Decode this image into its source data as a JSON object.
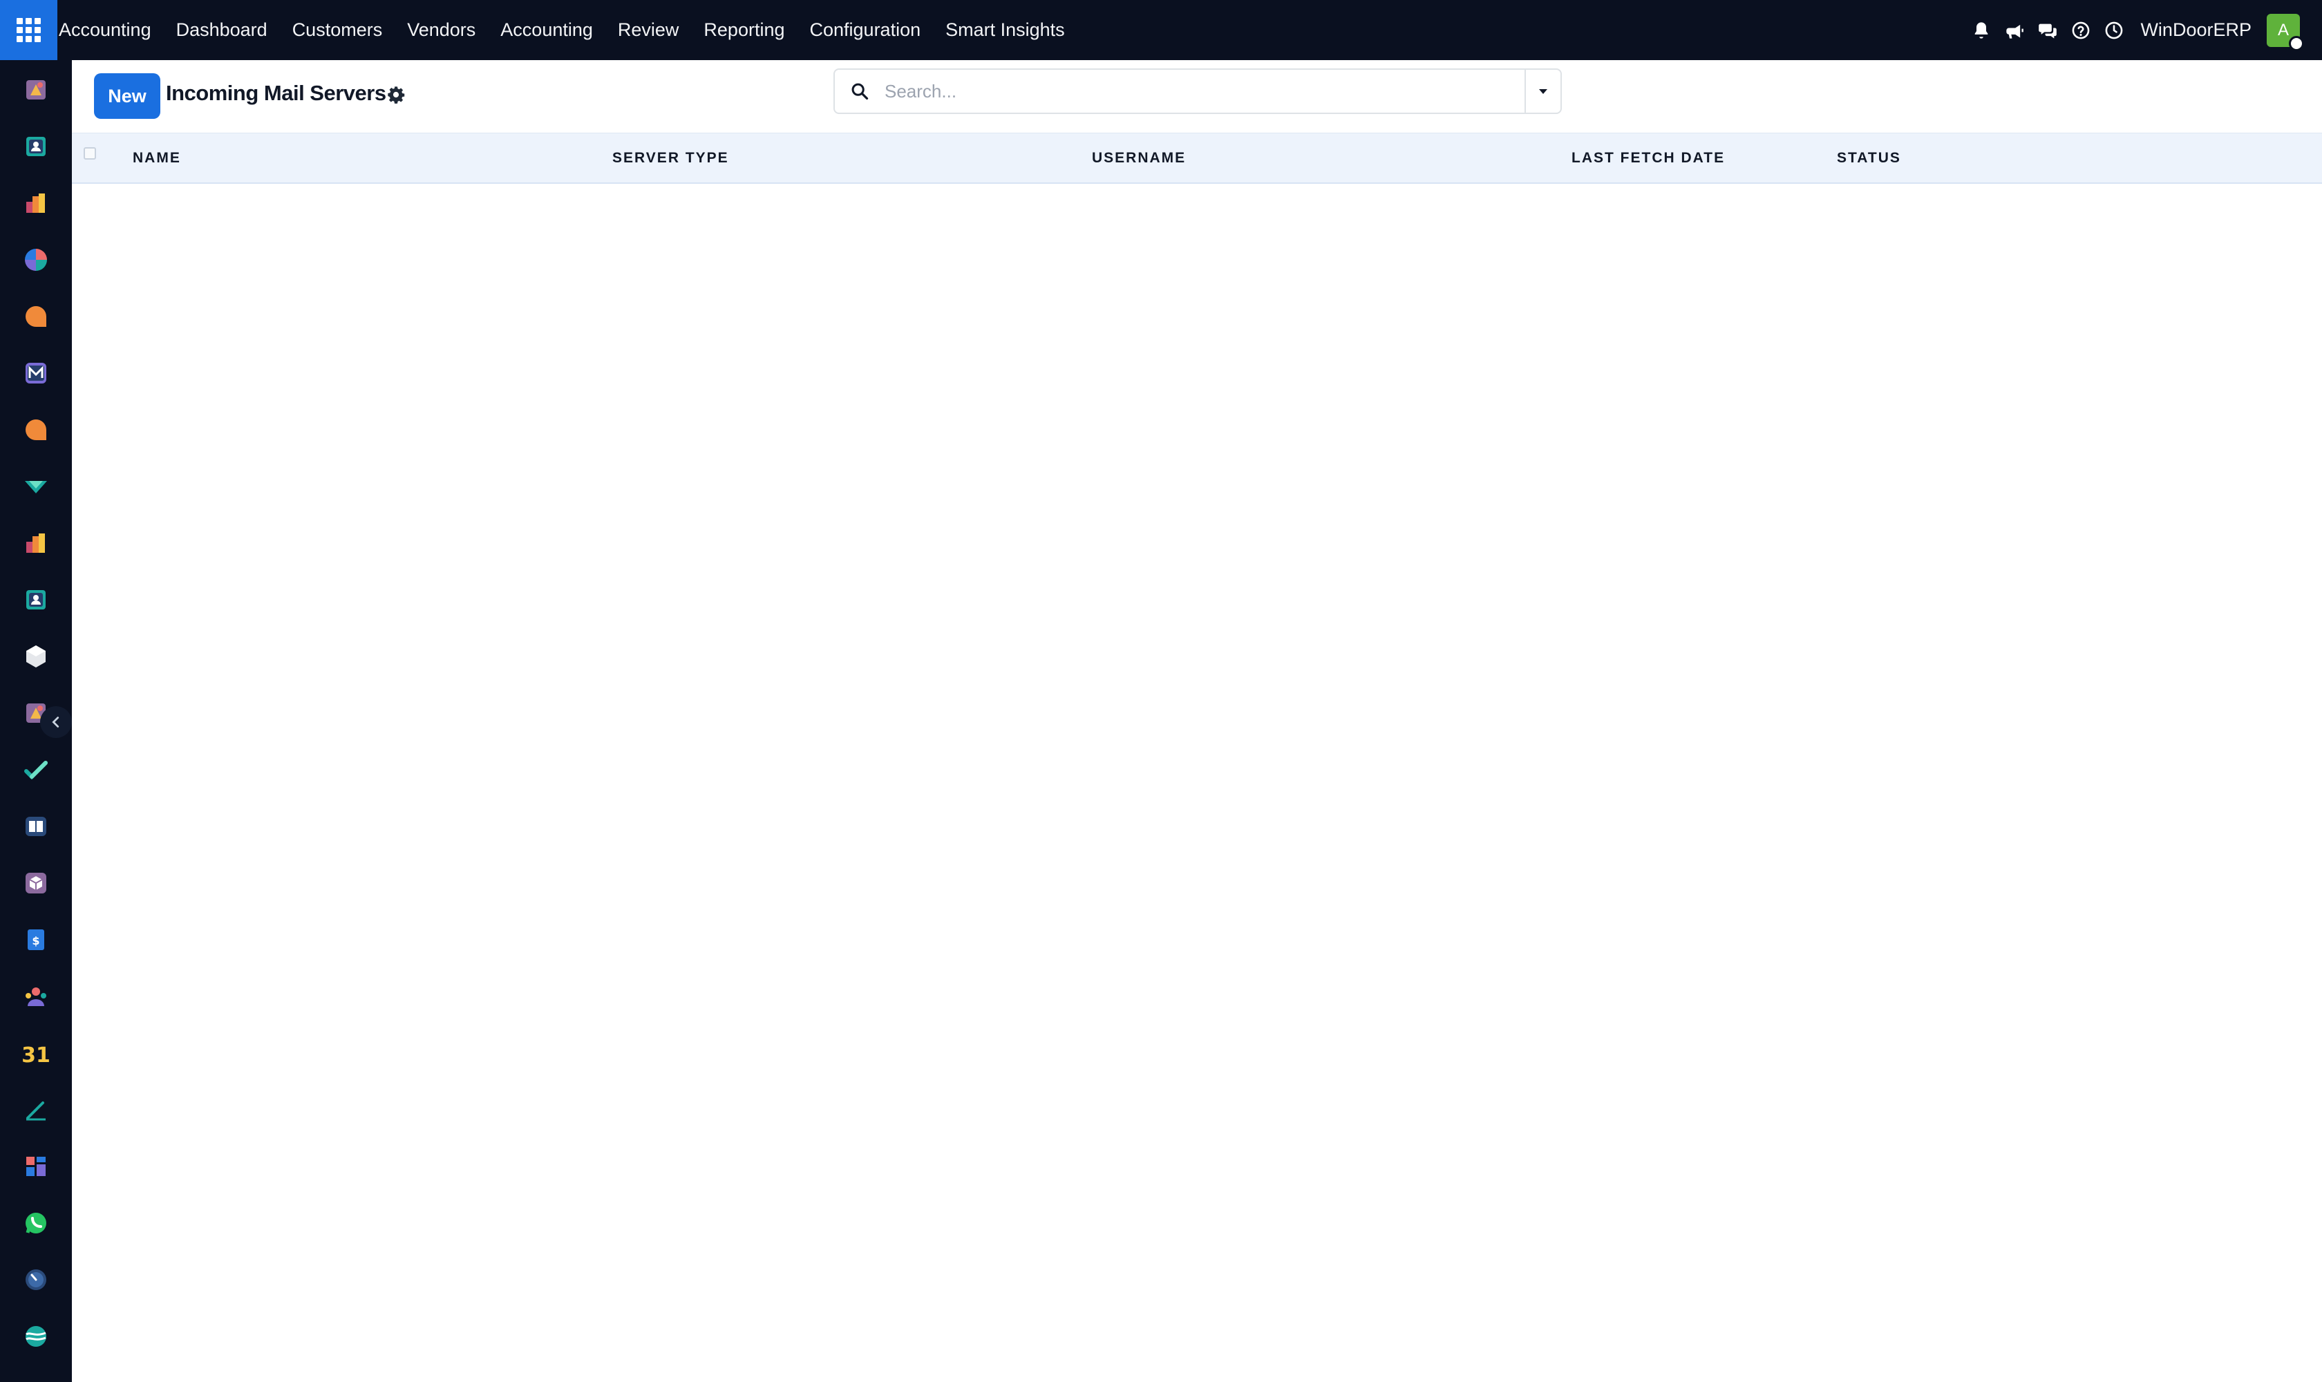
{
  "topbar": {
    "apps_icon": "grid-icon",
    "nav": [
      "Accounting",
      "Dashboard",
      "Customers",
      "Vendors",
      "Accounting",
      "Review",
      "Reporting",
      "Configuration",
      "Smart Insights"
    ],
    "icons": [
      "bell-icon",
      "megaphone-icon",
      "chat-icon",
      "help-icon",
      "clock-icon"
    ],
    "company": "WinDoorERP",
    "avatar_letter": "A",
    "bar_color": "#0a1020",
    "accent": "#1a6fe0"
  },
  "sidebar": {
    "apps": [
      "documents-app-icon",
      "contacts-app-icon",
      "accounting-app-icon",
      "discuss-app-icon",
      "live-chat-app-icon",
      "email-marketing-app-icon",
      "live-chat-app-icon",
      "website-app-icon",
      "accounting-app-icon",
      "contacts-app-icon",
      "inventory-app-icon",
      "documents-app-icon",
      "todo-app-icon",
      "knowledge-app-icon",
      "product-app-icon",
      "expenses-app-icon",
      "employees-app-icon",
      "calendar-app-icon",
      "sign-app-icon",
      "dashboards-app-icon",
      "whatsapp-app-icon",
      "timesheet-app-icon",
      "website-builder-app-icon"
    ],
    "calendar_day": "31"
  },
  "control_panel": {
    "new_label": "New",
    "title": "Incoming Mail Servers",
    "search_placeholder": "Search..."
  },
  "table": {
    "columns": [
      "NAME",
      "SERVER TYPE",
      "USERNAME",
      "LAST FETCH DATE",
      "STATUS"
    ],
    "rows": []
  }
}
